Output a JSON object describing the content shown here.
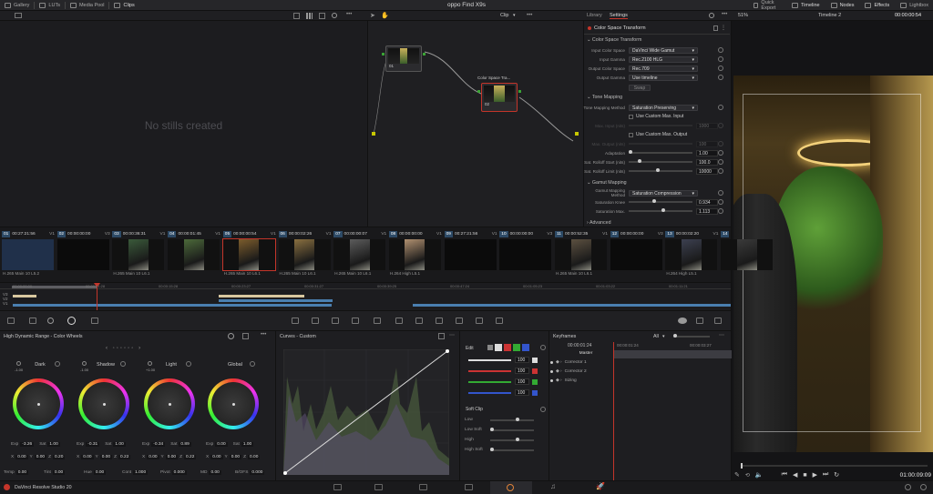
{
  "topbar": {
    "left_tabs": [
      "Gallery",
      "LUTs",
      "Media Pool",
      "Clips"
    ],
    "title": "oppo Find X9s",
    "right_tabs": [
      "Quick Export",
      "Timeline",
      "Nodes",
      "Effects",
      "Lightbox"
    ]
  },
  "subbar": {
    "clip_menu": "Clip",
    "panel_tabs": [
      "Library",
      "Settings"
    ],
    "zoom": "51%",
    "timeline_name": "Timeline 2",
    "timecode": "00:00:00:54"
  },
  "gallery": {
    "empty_text": "No stills created"
  },
  "nodes": [
    {
      "label": "01"
    },
    {
      "label": "02",
      "title": "Color Space Tra..."
    }
  ],
  "settings": {
    "header": "Color Space Transform",
    "section1": "Color Space Transform",
    "input_color_space_label": "Input Color Space",
    "input_color_space": "DaVinci Wide Gamut",
    "input_gamma_label": "Input Gamma",
    "input_gamma": "Rec.2100 HLG",
    "output_color_space_label": "Output Color Space",
    "output_color_space": "Rec.709",
    "output_gamma_label": "Output Gamma",
    "output_gamma": "Use timeline",
    "swap": "Swap",
    "section2": "Tone Mapping",
    "tone_method_label": "Tone Mapping Method",
    "tone_method": "Saturation Preserving",
    "use_max_input": "Use Custom Max. Input",
    "max_input_label": "Max. Input (nits)",
    "max_input": "1000",
    "use_max_output": "Use Custom Max. Output",
    "max_output_label": "Max. Output (nits)",
    "max_output": "100",
    "adaptation_label": "Adaptation",
    "adaptation": "1.00",
    "rolloff_start_label": "Sat. Rolloff Start (nits)",
    "rolloff_start": "100.0",
    "rolloff_limit_label": "Sat. Rolloff Limit (nits)",
    "rolloff_limit": "10000",
    "section3": "Gamut Mapping",
    "gamut_method_label": "Gamut Mapping Method",
    "gamut_method": "Saturation Compression",
    "sat_knee_label": "Saturation Knee",
    "sat_knee": "0.934",
    "sat_max_label": "Saturation Max.",
    "sat_max": "1.113",
    "section4": "Advanced"
  },
  "clips": [
    {
      "num": "01",
      "tc": "00:27:21:56",
      "track": "V1",
      "label": "H.265 Main 10 L5.2"
    },
    {
      "num": "02",
      "tc": "00:00:00:00",
      "track": "V3",
      "label": ""
    },
    {
      "num": "03",
      "tc": "00:00:36:31",
      "track": "V1",
      "label": "H.265 Main 10 L6.1"
    },
    {
      "num": "04",
      "tc": "00:00:01:45",
      "track": "V1",
      "label": ""
    },
    {
      "num": "05",
      "tc": "00:00:00:54",
      "track": "V1",
      "label": "H.265 Main 10 L6.1"
    },
    {
      "num": "06",
      "tc": "00:00:02:26",
      "track": "V1",
      "label": "H.265 Main 10 L6.1"
    },
    {
      "num": "07",
      "tc": "00:00:00:07",
      "track": "V1",
      "label": "H.265 Main 10 L6.1"
    },
    {
      "num": "08",
      "tc": "00:00:00:00",
      "track": "V1",
      "label": "H.264 High L5.1"
    },
    {
      "num": "09",
      "tc": "00:27:21:56",
      "track": "V1",
      "label": ""
    },
    {
      "num": "10",
      "tc": "00:00:00:00",
      "track": "V3",
      "label": ""
    },
    {
      "num": "11",
      "tc": "00:00:52:35",
      "track": "V1",
      "label": "H.265 Main 10 L6.1"
    },
    {
      "num": "12",
      "tc": "00:00:00:00",
      "track": "V3",
      "label": ""
    },
    {
      "num": "13",
      "tc": "00:00:02:20",
      "track": "V1",
      "label": "H.264 High L5.1"
    },
    {
      "num": "14",
      "tc": "",
      "track": "",
      "label": ""
    }
  ],
  "ruler": [
    "00:00:00:00",
    "00:00:01:28",
    "00:00:15:28",
    "00:00:23:27",
    "00:00:31:27",
    "00:00:39:25",
    "00:00:47:24",
    "00:01:05:23",
    "00:01:03:22",
    "00:01:11:21"
  ],
  "tracks": [
    "V3",
    "V2",
    "V1"
  ],
  "wheels": {
    "title": "High Dynamic Range - Color Wheels",
    "items": [
      {
        "name": "Dark",
        "zone": "-1.00",
        "exp": "-3.26",
        "sat": "1.00",
        "x": "0.00",
        "y": "0.00",
        "z": "0.20"
      },
      {
        "name": "Shadow",
        "zone": "-1.00",
        "exp": "-0.31",
        "sat": "1.00",
        "x": "0.00",
        "y": "0.00",
        "z": "0.22"
      },
      {
        "name": "Light",
        "zone": "+1.00",
        "exp": "-0.34",
        "sat": "0.89",
        "x": "0.00",
        "y": "0.00",
        "z": "0.22"
      },
      {
        "name": "Global",
        "zone": "",
        "exp": "0.00",
        "sat": "1.00",
        "x": "0.00",
        "y": "0.00",
        "z": "0.00"
      }
    ],
    "bottom": [
      {
        "k": "Temp",
        "v": "0.00"
      },
      {
        "k": "Tint",
        "v": "0.00"
      },
      {
        "k": "Hue",
        "v": "0.00"
      },
      {
        "k": "Cont",
        "v": "1.000"
      },
      {
        "k": "Pivot",
        "v": "0.000"
      },
      {
        "k": "MD",
        "v": "0.00"
      },
      {
        "k": "B/OFS",
        "v": "0.000"
      }
    ]
  },
  "curves": {
    "title": "Curves - Custom"
  },
  "edit": {
    "label": "Edit",
    "channel_values": [
      "100",
      "100",
      "100",
      "100"
    ],
    "soft_clip": "Soft Clip",
    "soft_rows": [
      "Low",
      "Low Soft",
      "High",
      "High Soft"
    ]
  },
  "keyframes": {
    "title": "Keyframes",
    "filter": "All",
    "time": "00:00:01:24",
    "ruler": [
      "00:00:01:24",
      "00:00:03:27"
    ],
    "rows": [
      "Master",
      "Corrector 1",
      "Corrector 2",
      "Sizing"
    ]
  },
  "viewer": {
    "timecode": "01:00:09:09"
  },
  "app_name": "DaVinci Resolve Studio 20",
  "colors": {
    "accent": "#c4352a",
    "selection": "#2d4a66",
    "panel": "#1e1e21"
  }
}
